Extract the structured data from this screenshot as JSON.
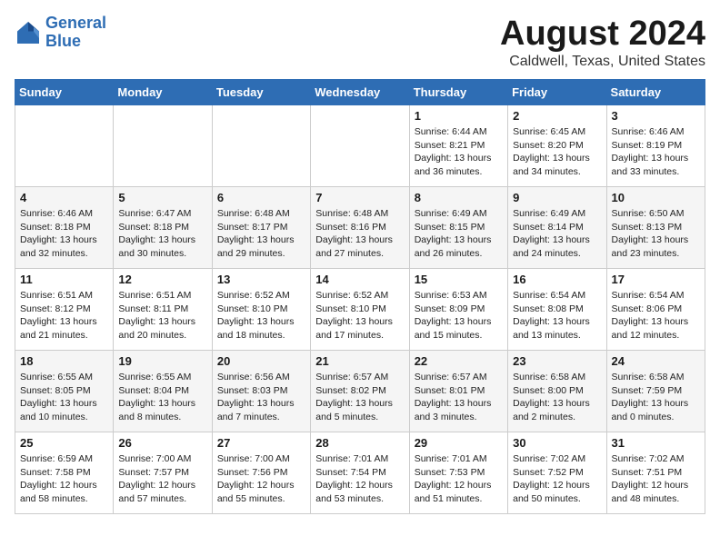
{
  "header": {
    "logo_line1": "General",
    "logo_line2": "Blue",
    "month": "August 2024",
    "location": "Caldwell, Texas, United States"
  },
  "weekdays": [
    "Sunday",
    "Monday",
    "Tuesday",
    "Wednesday",
    "Thursday",
    "Friday",
    "Saturday"
  ],
  "weeks": [
    [
      {
        "day": "",
        "info": ""
      },
      {
        "day": "",
        "info": ""
      },
      {
        "day": "",
        "info": ""
      },
      {
        "day": "",
        "info": ""
      },
      {
        "day": "1",
        "info": "Sunrise: 6:44 AM\nSunset: 8:21 PM\nDaylight: 13 hours\nand 36 minutes."
      },
      {
        "day": "2",
        "info": "Sunrise: 6:45 AM\nSunset: 8:20 PM\nDaylight: 13 hours\nand 34 minutes."
      },
      {
        "day": "3",
        "info": "Sunrise: 6:46 AM\nSunset: 8:19 PM\nDaylight: 13 hours\nand 33 minutes."
      }
    ],
    [
      {
        "day": "4",
        "info": "Sunrise: 6:46 AM\nSunset: 8:18 PM\nDaylight: 13 hours\nand 32 minutes."
      },
      {
        "day": "5",
        "info": "Sunrise: 6:47 AM\nSunset: 8:18 PM\nDaylight: 13 hours\nand 30 minutes."
      },
      {
        "day": "6",
        "info": "Sunrise: 6:48 AM\nSunset: 8:17 PM\nDaylight: 13 hours\nand 29 minutes."
      },
      {
        "day": "7",
        "info": "Sunrise: 6:48 AM\nSunset: 8:16 PM\nDaylight: 13 hours\nand 27 minutes."
      },
      {
        "day": "8",
        "info": "Sunrise: 6:49 AM\nSunset: 8:15 PM\nDaylight: 13 hours\nand 26 minutes."
      },
      {
        "day": "9",
        "info": "Sunrise: 6:49 AM\nSunset: 8:14 PM\nDaylight: 13 hours\nand 24 minutes."
      },
      {
        "day": "10",
        "info": "Sunrise: 6:50 AM\nSunset: 8:13 PM\nDaylight: 13 hours\nand 23 minutes."
      }
    ],
    [
      {
        "day": "11",
        "info": "Sunrise: 6:51 AM\nSunset: 8:12 PM\nDaylight: 13 hours\nand 21 minutes."
      },
      {
        "day": "12",
        "info": "Sunrise: 6:51 AM\nSunset: 8:11 PM\nDaylight: 13 hours\nand 20 minutes."
      },
      {
        "day": "13",
        "info": "Sunrise: 6:52 AM\nSunset: 8:10 PM\nDaylight: 13 hours\nand 18 minutes."
      },
      {
        "day": "14",
        "info": "Sunrise: 6:52 AM\nSunset: 8:10 PM\nDaylight: 13 hours\nand 17 minutes."
      },
      {
        "day": "15",
        "info": "Sunrise: 6:53 AM\nSunset: 8:09 PM\nDaylight: 13 hours\nand 15 minutes."
      },
      {
        "day": "16",
        "info": "Sunrise: 6:54 AM\nSunset: 8:08 PM\nDaylight: 13 hours\nand 13 minutes."
      },
      {
        "day": "17",
        "info": "Sunrise: 6:54 AM\nSunset: 8:06 PM\nDaylight: 13 hours\nand 12 minutes."
      }
    ],
    [
      {
        "day": "18",
        "info": "Sunrise: 6:55 AM\nSunset: 8:05 PM\nDaylight: 13 hours\nand 10 minutes."
      },
      {
        "day": "19",
        "info": "Sunrise: 6:55 AM\nSunset: 8:04 PM\nDaylight: 13 hours\nand 8 minutes."
      },
      {
        "day": "20",
        "info": "Sunrise: 6:56 AM\nSunset: 8:03 PM\nDaylight: 13 hours\nand 7 minutes."
      },
      {
        "day": "21",
        "info": "Sunrise: 6:57 AM\nSunset: 8:02 PM\nDaylight: 13 hours\nand 5 minutes."
      },
      {
        "day": "22",
        "info": "Sunrise: 6:57 AM\nSunset: 8:01 PM\nDaylight: 13 hours\nand 3 minutes."
      },
      {
        "day": "23",
        "info": "Sunrise: 6:58 AM\nSunset: 8:00 PM\nDaylight: 13 hours\nand 2 minutes."
      },
      {
        "day": "24",
        "info": "Sunrise: 6:58 AM\nSunset: 7:59 PM\nDaylight: 13 hours\nand 0 minutes."
      }
    ],
    [
      {
        "day": "25",
        "info": "Sunrise: 6:59 AM\nSunset: 7:58 PM\nDaylight: 12 hours\nand 58 minutes."
      },
      {
        "day": "26",
        "info": "Sunrise: 7:00 AM\nSunset: 7:57 PM\nDaylight: 12 hours\nand 57 minutes."
      },
      {
        "day": "27",
        "info": "Sunrise: 7:00 AM\nSunset: 7:56 PM\nDaylight: 12 hours\nand 55 minutes."
      },
      {
        "day": "28",
        "info": "Sunrise: 7:01 AM\nSunset: 7:54 PM\nDaylight: 12 hours\nand 53 minutes."
      },
      {
        "day": "29",
        "info": "Sunrise: 7:01 AM\nSunset: 7:53 PM\nDaylight: 12 hours\nand 51 minutes."
      },
      {
        "day": "30",
        "info": "Sunrise: 7:02 AM\nSunset: 7:52 PM\nDaylight: 12 hours\nand 50 minutes."
      },
      {
        "day": "31",
        "info": "Sunrise: 7:02 AM\nSunset: 7:51 PM\nDaylight: 12 hours\nand 48 minutes."
      }
    ]
  ]
}
